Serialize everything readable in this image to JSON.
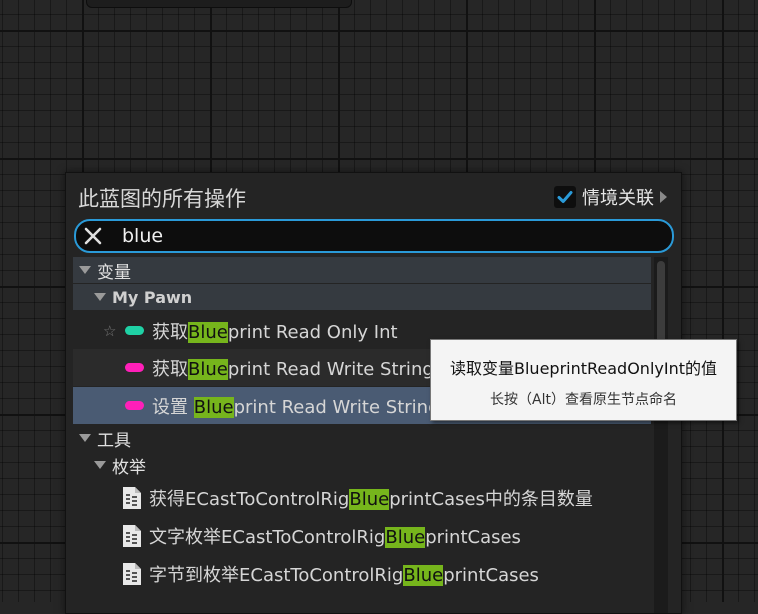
{
  "panel": {
    "title": "此蓝图的所有操作",
    "context_sensitive": {
      "checked": true,
      "label": "情境关联"
    }
  },
  "search": {
    "value": "blue",
    "placeholder": ""
  },
  "tree": {
    "variables": {
      "label": "变量",
      "group": "My Pawn",
      "items": [
        {
          "pre": "获取",
          "hl": "Blue",
          "post": "print Read Only Int",
          "pin_color": "#1fd1a5",
          "icon": "bool-pin-icon"
        },
        {
          "pre": "获取",
          "hl": "Blue",
          "post": "print Read Write String",
          "pin_color": "#ff1fb9",
          "icon": "string-pin-icon"
        },
        {
          "pre": "设置 ",
          "hl": "Blue",
          "post": "print Read Write String",
          "pin_color": "#ff1fb9",
          "icon": "string-pin-icon"
        }
      ]
    },
    "tools": {
      "label": "工具",
      "group": "枚举",
      "items": [
        {
          "pre": "获得ECastToControlRig",
          "hl": "Blue",
          "post": "printCases中的条目数量",
          "icon": "function-icon"
        },
        {
          "pre": "文字枚举ECastToControlRig",
          "hl": "Blue",
          "post": "printCases",
          "icon": "function-icon"
        },
        {
          "pre": "字节到枚举ECastToControlRig",
          "hl": "Blue",
          "post": "printCases",
          "icon": "function-icon"
        }
      ]
    }
  },
  "tooltip": {
    "main": "读取变量BlueprintReadOnlyInt的值",
    "sub": "长按（Alt）查看原生节点命名"
  }
}
